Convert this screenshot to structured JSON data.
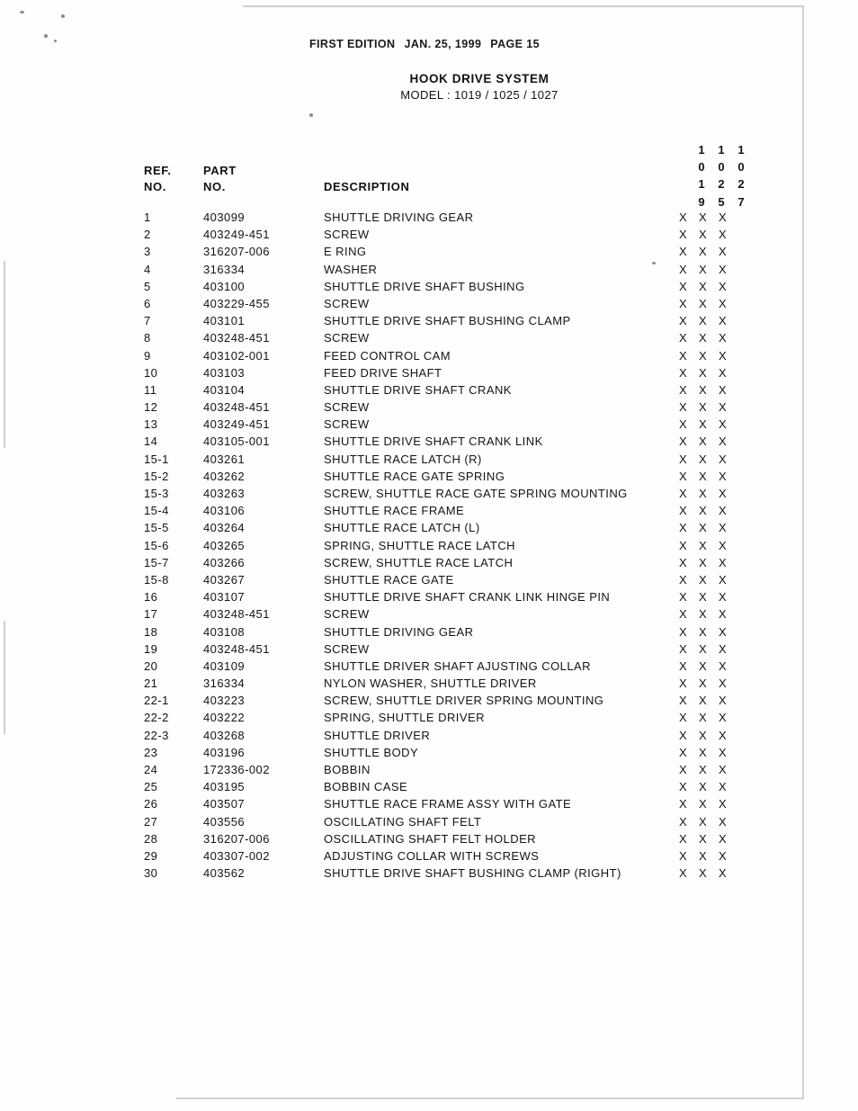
{
  "header": {
    "edition": "FIRST EDITION",
    "date": "JAN. 25, 1999",
    "page": "PAGE 15"
  },
  "title": {
    "main": "HOOK DRIVE SYSTEM",
    "sub": "MODEL : 1019 / 1025 / 1027"
  },
  "columns": {
    "ref_line1": "REF.",
    "ref_line2": "NO.",
    "part_line1": "PART",
    "part_line2": "NO.",
    "description": "DESCRIPTION",
    "model_digits": [
      [
        "1",
        "1",
        "1"
      ],
      [
        "0",
        "0",
        "0"
      ],
      [
        "1",
        "2",
        "2"
      ],
      [
        "9",
        "5",
        "7"
      ]
    ]
  },
  "mark": "X",
  "rows": [
    {
      "ref": "1",
      "part": "403099",
      "desc": "SHUTTLE DRIVING GEAR",
      "marks": [
        "X",
        "X",
        "X"
      ]
    },
    {
      "ref": "2",
      "part": "403249-451",
      "desc": "SCREW",
      "marks": [
        "X",
        "X",
        "X"
      ]
    },
    {
      "ref": "3",
      "part": "316207-006",
      "desc": "E RING",
      "marks": [
        "X",
        "X",
        "X"
      ]
    },
    {
      "ref": "4",
      "part": "316334",
      "desc": "WASHER",
      "marks": [
        "X",
        "X",
        "X"
      ]
    },
    {
      "ref": "5",
      "part": "403100",
      "desc": "SHUTTLE DRIVE SHAFT BUSHING",
      "marks": [
        "X",
        "X",
        "X"
      ]
    },
    {
      "ref": "6",
      "part": "403229-455",
      "desc": "SCREW",
      "marks": [
        "X",
        "X",
        "X"
      ]
    },
    {
      "ref": "7",
      "part": "403101",
      "desc": "SHUTTLE DRIVE SHAFT BUSHING CLAMP",
      "marks": [
        "X",
        "X",
        "X"
      ]
    },
    {
      "ref": "8",
      "part": "403248-451",
      "desc": "SCREW",
      "marks": [
        "X",
        "X",
        "X"
      ]
    },
    {
      "ref": "9",
      "part": "403102-001",
      "desc": "FEED CONTROL CAM",
      "marks": [
        "X",
        "X",
        "X"
      ]
    },
    {
      "ref": "10",
      "part": "403103",
      "desc": "FEED DRIVE SHAFT",
      "marks": [
        "X",
        "X",
        "X"
      ]
    },
    {
      "ref": "11",
      "part": "403104",
      "desc": "SHUTTLE DRIVE SHAFT CRANK",
      "marks": [
        "X",
        "X",
        "X"
      ]
    },
    {
      "ref": "12",
      "part": "403248-451",
      "desc": "SCREW",
      "marks": [
        "X",
        "X",
        "X"
      ]
    },
    {
      "ref": "13",
      "part": "403249-451",
      "desc": "SCREW",
      "marks": [
        "X",
        "X",
        "X"
      ]
    },
    {
      "ref": "14",
      "part": "403105-001",
      "desc": "SHUTTLE DRIVE SHAFT CRANK LINK",
      "marks": [
        "X",
        "X",
        "X"
      ]
    },
    {
      "ref": "15-1",
      "part": "403261",
      "desc": "SHUTTLE RACE LATCH (R)",
      "marks": [
        "X",
        "X",
        "X"
      ]
    },
    {
      "ref": "15-2",
      "part": "403262",
      "desc": "SHUTTLE RACE GATE SPRING",
      "marks": [
        "X",
        "X",
        "X"
      ]
    },
    {
      "ref": "15-3",
      "part": "403263",
      "desc": "SCREW, SHUTTLE RACE GATE SPRING MOUNTING",
      "marks": [
        "X",
        "X",
        "X"
      ]
    },
    {
      "ref": "15-4",
      "part": "403106",
      "desc": "SHUTTLE RACE FRAME",
      "marks": [
        "X",
        "X",
        "X"
      ]
    },
    {
      "ref": "15-5",
      "part": "403264",
      "desc": "SHUTTLE RACE LATCH (L)",
      "marks": [
        "X",
        "X",
        "X"
      ]
    },
    {
      "ref": "15-6",
      "part": "403265",
      "desc": "SPRING, SHUTTLE RACE LATCH",
      "marks": [
        "X",
        "X",
        "X"
      ]
    },
    {
      "ref": "15-7",
      "part": "403266",
      "desc": "SCREW, SHUTTLE RACE LATCH",
      "marks": [
        "X",
        "X",
        "X"
      ]
    },
    {
      "ref": "15-8",
      "part": "403267",
      "desc": "SHUTTLE RACE GATE",
      "marks": [
        "X",
        "X",
        "X"
      ]
    },
    {
      "ref": "16",
      "part": "403107",
      "desc": "SHUTTLE DRIVE SHAFT CRANK LINK HINGE PIN",
      "marks": [
        "X",
        "X",
        "X"
      ]
    },
    {
      "ref": "17",
      "part": "403248-451",
      "desc": "SCREW",
      "marks": [
        "X",
        "X",
        "X"
      ]
    },
    {
      "ref": "18",
      "part": "403108",
      "desc": "SHUTTLE DRIVING GEAR",
      "marks": [
        "X",
        "X",
        "X"
      ]
    },
    {
      "ref": "19",
      "part": "403248-451",
      "desc": "SCREW",
      "marks": [
        "X",
        "X",
        "X"
      ]
    },
    {
      "ref": "20",
      "part": "403109",
      "desc": "SHUTTLE DRIVER SHAFT AJUSTING COLLAR",
      "marks": [
        "X",
        "X",
        "X"
      ]
    },
    {
      "ref": "21",
      "part": "316334",
      "desc": "NYLON WASHER, SHUTTLE DRIVER",
      "marks": [
        "X",
        "X",
        "X"
      ]
    },
    {
      "ref": "22-1",
      "part": "403223",
      "desc": "SCREW, SHUTTLE DRIVER  SPRING MOUNTING",
      "marks": [
        "X",
        "X",
        "X"
      ]
    },
    {
      "ref": "22-2",
      "part": "403222",
      "desc": "SPRING, SHUTTLE DRIVER",
      "marks": [
        "X",
        "X",
        "X"
      ]
    },
    {
      "ref": "22-3",
      "part": "403268",
      "desc": "SHUTTLE DRIVER",
      "marks": [
        "X",
        "X",
        "X"
      ]
    },
    {
      "ref": "23",
      "part": "403196",
      "desc": "SHUTTLE  BODY",
      "marks": [
        "X",
        "X",
        "X"
      ]
    },
    {
      "ref": "24",
      "part": "172336-002",
      "desc": "BOBBIN",
      "marks": [
        "X",
        "X",
        "X"
      ]
    },
    {
      "ref": "25",
      "part": "403195",
      "desc": "BOBBIN CASE",
      "marks": [
        "X",
        "X",
        "X"
      ]
    },
    {
      "ref": "26",
      "part": "403507",
      "desc": "SHUTTLE RACE FRAME ASSY WITH GATE",
      "marks": [
        "X",
        "X",
        "X"
      ]
    },
    {
      "ref": "27",
      "part": "403556",
      "desc": "OSCILLATING SHAFT FELT",
      "marks": [
        "X",
        "X",
        "X"
      ]
    },
    {
      "ref": "28",
      "part": "316207-006",
      "desc": "OSCILLATING SHAFT FELT HOLDER",
      "marks": [
        "X",
        "X",
        "X"
      ]
    },
    {
      "ref": "29",
      "part": "403307-002",
      "desc": "ADJUSTING COLLAR  WITH SCREWS",
      "marks": [
        "X",
        "X",
        "X"
      ]
    },
    {
      "ref": "30",
      "part": "403562",
      "desc": "SHUTTLE DRIVE SHAFT BUSHING CLAMP (RIGHT)",
      "marks": [
        "X",
        "X",
        "X"
      ]
    }
  ]
}
